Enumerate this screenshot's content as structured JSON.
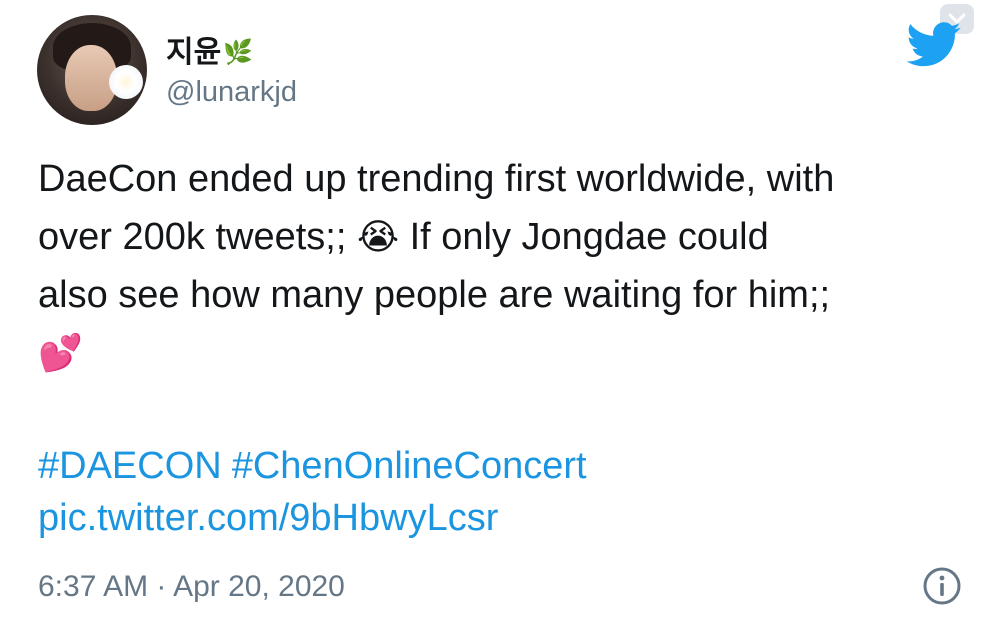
{
  "author": {
    "display_name": "지윤",
    "name_emoji": "🌿",
    "handle": "@lunarkjd"
  },
  "tweet": {
    "line1": "DaeCon ended up trending first worldwide, with",
    "line2_start": "over 200k tweets;; ",
    "crying_emoji": "😭",
    "line2_end": " If only Jongdae could",
    "line3": "also see how many people are waiting for him;;",
    "hearts_emoji": "💕",
    "hashtags": [
      "#DAECON",
      "#ChenOnlineConcert"
    ],
    "link": "pic.twitter.com/9bHbwyLcsr",
    "timestamp": "6:37 AM · Apr 20, 2020"
  },
  "colors": {
    "link": "#1b95e0",
    "text": "#14171a",
    "muted": "#657786",
    "twitter_blue": "#1da1f2"
  },
  "icons": {
    "brand": "twitter-bird-icon",
    "menu": "chevron-down-icon",
    "info": "info-icon"
  }
}
